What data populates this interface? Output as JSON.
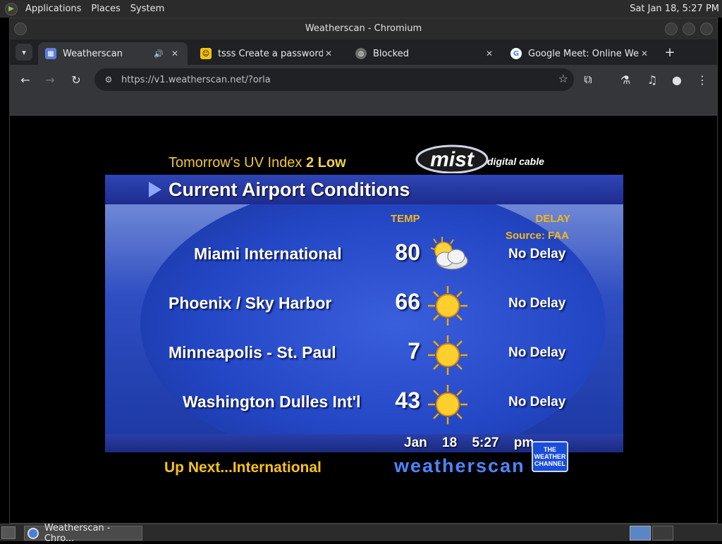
{
  "top_panel": {
    "menus": [
      "Applications",
      "Places",
      "System"
    ],
    "clock": "Sat Jan 18,  5:27 PM"
  },
  "window": {
    "title": "Weatherscan - Chromium"
  },
  "tabs": [
    {
      "title": "Weatherscan",
      "active": true,
      "favicon": "weatherscan-favicon"
    },
    {
      "title": "tsss Create a password-p",
      "active": false,
      "favicon": "emoji-favicon"
    },
    {
      "title": "Blocked",
      "active": false,
      "favicon": "globe-icon"
    },
    {
      "title": "Google Meet: Online Web",
      "active": false,
      "favicon": "google-icon"
    }
  ],
  "toolbar": {
    "url": "https://v1.weatherscan.net/?orla"
  },
  "weatherscan": {
    "uv_prefix": "Tomorrow's UV Index",
    "uv_value": "2 Low",
    "provider": "mist",
    "provider_suffix": "digital cable",
    "banner": "Current Airport Conditions",
    "temp_header": "TEMP",
    "delay_header": "DELAY",
    "source": "Source: FAA",
    "airports": [
      {
        "name": "Miami International",
        "temp": "80",
        "icon": "partly-cloudy-icon",
        "delay": "No Delay"
      },
      {
        "name": "Phoenix / Sky Harbor",
        "temp": "66",
        "icon": "sunny-icon",
        "delay": "No Delay"
      },
      {
        "name": "Minneapolis - St. Paul",
        "temp": "7",
        "icon": "sunny-icon",
        "delay": "No Delay"
      },
      {
        "name": "Washington Dulles Int'l",
        "temp": "43",
        "icon": "sunny-icon",
        "delay": "No Delay"
      }
    ],
    "date": "Jan 18",
    "time": "5:27 pm",
    "up_next": "Up Next...International",
    "brand": "weatherscan",
    "channel_logo": "THE WEATHER CHANNEL"
  },
  "taskbar": {
    "task_label": "Weatherscan - Chro..."
  },
  "colors": {
    "accent_yellow": "#f6b817",
    "banner_blue": "#2f45b6",
    "brand_blue": "#4b86ff"
  }
}
